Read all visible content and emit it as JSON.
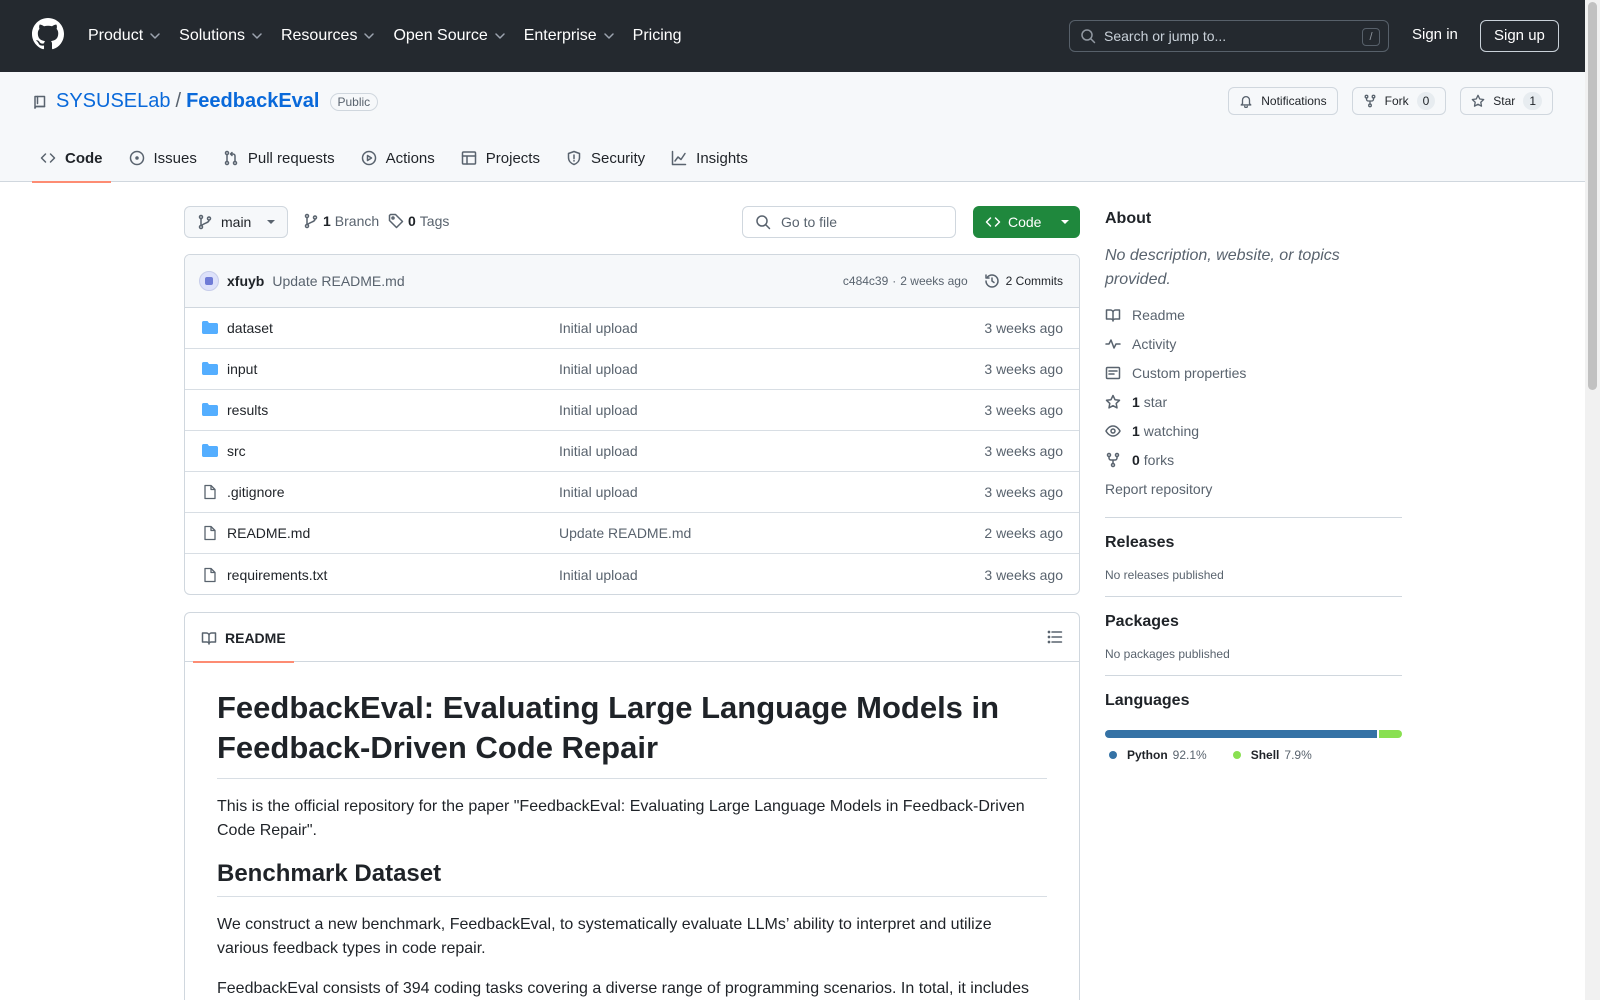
{
  "header": {
    "nav": [
      {
        "label": "Product",
        "dropdown": true
      },
      {
        "label": "Solutions",
        "dropdown": true
      },
      {
        "label": "Resources",
        "dropdown": true
      },
      {
        "label": "Open Source",
        "dropdown": true
      },
      {
        "label": "Enterprise",
        "dropdown": true
      },
      {
        "label": "Pricing",
        "dropdown": false
      }
    ],
    "search_placeholder": "Search or jump to...",
    "search_shortcut": "/",
    "sign_in": "Sign in",
    "sign_up": "Sign up"
  },
  "repo": {
    "owner": "SYSUSELab",
    "separator": "/",
    "name": "FeedbackEval",
    "visibility": "Public",
    "notifications_label": "Notifications",
    "fork_label": "Fork",
    "fork_count": "0",
    "star_label": "Star",
    "star_count": "1",
    "tabs": [
      {
        "label": "Code",
        "icon": "code-icon",
        "active": true
      },
      {
        "label": "Issues",
        "icon": "issue-icon",
        "active": false
      },
      {
        "label": "Pull requests",
        "icon": "pull-request-icon",
        "active": false
      },
      {
        "label": "Actions",
        "icon": "play-icon",
        "active": false
      },
      {
        "label": "Projects",
        "icon": "table-icon",
        "active": false
      },
      {
        "label": "Security",
        "icon": "shield-icon",
        "active": false
      },
      {
        "label": "Insights",
        "icon": "graph-icon",
        "active": false
      }
    ]
  },
  "toolbar": {
    "branch": "main",
    "branch_count": "1",
    "branch_label": "Branch",
    "tag_count": "0",
    "tag_label": "Tags",
    "go_to_file": "Go to file",
    "code_button": "Code"
  },
  "commit": {
    "author": "xfuyb",
    "message": "Update README.md",
    "hash": "c484c39",
    "separator": "·",
    "time": "2 weeks ago",
    "commits_label": "2 Commits"
  },
  "files": [
    {
      "name": "dataset",
      "type": "folder",
      "commit": "Initial upload",
      "time": "3 weeks ago"
    },
    {
      "name": "input",
      "type": "folder",
      "commit": "Initial upload",
      "time": "3 weeks ago"
    },
    {
      "name": "results",
      "type": "folder",
      "commit": "Initial upload",
      "time": "3 weeks ago"
    },
    {
      "name": "src",
      "type": "folder",
      "commit": "Initial upload",
      "time": "3 weeks ago"
    },
    {
      "name": ".gitignore",
      "type": "file",
      "commit": "Initial upload",
      "time": "3 weeks ago"
    },
    {
      "name": "README.md",
      "type": "file",
      "commit": "Update README.md",
      "time": "2 weeks ago"
    },
    {
      "name": "requirements.txt",
      "type": "file",
      "commit": "Initial upload",
      "time": "3 weeks ago"
    }
  ],
  "readme": {
    "tab_label": "README",
    "title": "FeedbackEval: Evaluating Large Language Models in Feedback-Driven Code Repair",
    "intro": "This is the official repository for the paper \"FeedbackEval: Evaluating Large Language Models in Feedback-Driven Code Repair\".",
    "section_title": "Benchmark Dataset",
    "section_p1": "We construct a new benchmark, FeedbackEval, to systematically evaluate LLMs’ ability to interpret and utilize various feedback types in code repair.",
    "section_p2": "FeedbackEval consists of 394 coding tasks covering a diverse range of programming scenarios. In total, it includes"
  },
  "sidebar": {
    "about_title": "About",
    "about_desc": "No description, website, or topics provided.",
    "links": [
      {
        "icon": "book-icon",
        "count": "",
        "label": "Readme"
      },
      {
        "icon": "pulse-icon",
        "count": "",
        "label": "Activity"
      },
      {
        "icon": "note-icon",
        "count": "",
        "label": "Custom properties"
      },
      {
        "icon": "star-icon",
        "count": "1",
        "label": "star"
      },
      {
        "icon": "eye-icon",
        "count": "1",
        "label": "watching"
      },
      {
        "icon": "fork-icon",
        "count": "0",
        "label": "forks"
      }
    ],
    "report": "Report repository",
    "releases_title": "Releases",
    "releases_note": "No releases published",
    "packages_title": "Packages",
    "packages_note": "No packages published",
    "languages_title": "Languages",
    "languages": [
      {
        "name": "Python",
        "percent": "92.1%",
        "value": 92.1,
        "color": "#3572A5"
      },
      {
        "name": "Shell",
        "percent": "7.9%",
        "value": 7.9,
        "color": "#89e051"
      }
    ]
  }
}
